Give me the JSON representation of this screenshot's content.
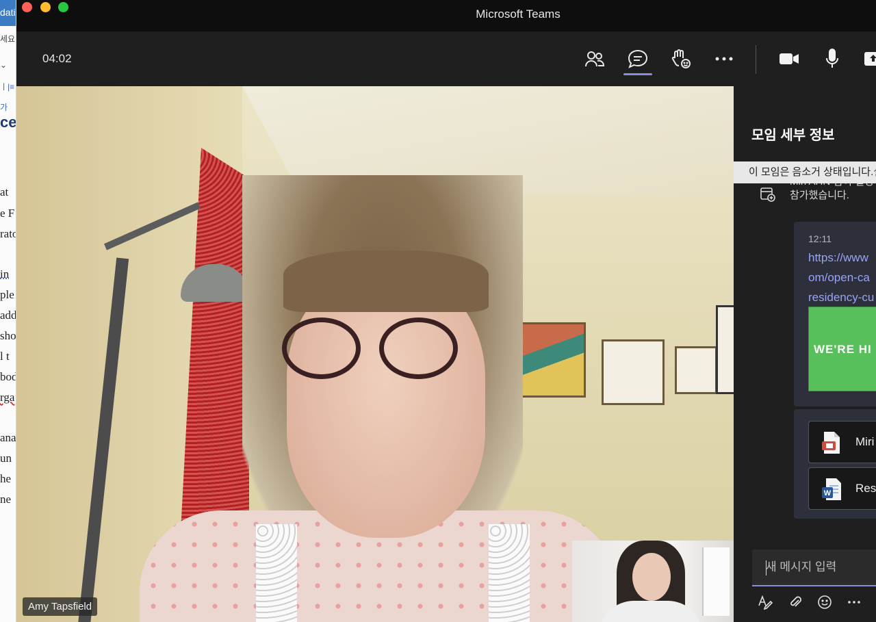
{
  "background_app": {
    "fragments": [
      "dati",
      "세요",
      "⌄",
      "ㅣ|≡",
      "가",
      "ce",
      "at",
      "e F",
      "rato",
      "in",
      "ple",
      "add",
      "sho",
      "l t",
      "bod",
      "rga",
      "ana",
      "un",
      "he",
      "ne"
    ]
  },
  "window": {
    "title": "Microsoft Teams"
  },
  "toolbar": {
    "timer": "04:02",
    "buttons": [
      {
        "name": "participants-icon"
      },
      {
        "name": "chat-icon",
        "active": true
      },
      {
        "name": "raise-hand-icon"
      },
      {
        "name": "more-options-icon"
      },
      {
        "name": "camera-icon"
      },
      {
        "name": "microphone-icon"
      },
      {
        "name": "share-icon"
      }
    ]
  },
  "video": {
    "participant_name": "Amy Tapsfield"
  },
  "panel": {
    "title": "모임 세부 정보",
    "muted_banner": "이 모임은 음소거 상태입니다.",
    "muted_banner_link": "설",
    "system_message_line1": "Miri AHN 님이 설정",
    "system_message_line2": "참가했습니다.",
    "message": {
      "time": "12:11",
      "link_lines": [
        "https://www",
        "om/open-ca",
        "residency-cu"
      ],
      "preview_text": "WE'RE HI"
    },
    "files": [
      {
        "name": "Miri",
        "type": "pdf"
      },
      {
        "name": "Res",
        "type": "word"
      }
    ],
    "composer": {
      "placeholder": "새 메시지 입력"
    }
  },
  "colors": {
    "accent": "#8b8cdb",
    "traffic_red": "#fe5f57",
    "traffic_yellow": "#febc2e",
    "traffic_green": "#28c840",
    "hiring_green": "#58c05a"
  }
}
